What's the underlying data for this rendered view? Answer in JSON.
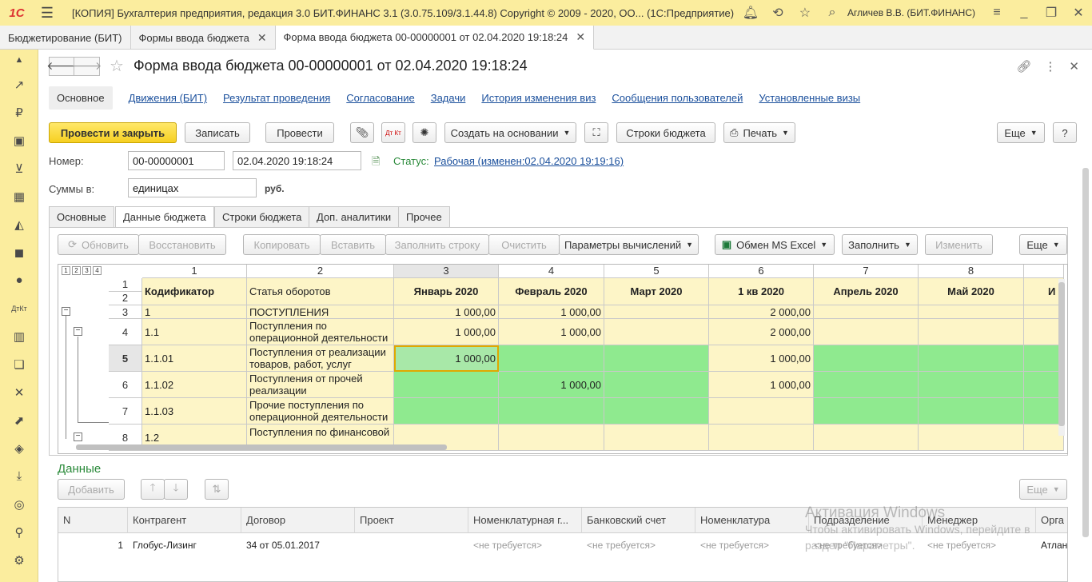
{
  "topbar": {
    "title": "[КОПИЯ] Бухгалтерия предприятия, редакция 3.0  БИТ.ФИНАНС 3.1 (3.0.75.109/3.1.44.8) Copyright © 2009 - 2020, ОО...   (1С:Предприятие)",
    "user": "Агличев В.В. (БИТ.ФИНАНС)",
    "logo": "1С"
  },
  "window_tabs": [
    {
      "label": "Бюджетирование (БИТ)"
    },
    {
      "label": "Формы ввода бюджета"
    },
    {
      "label": "Форма ввода бюджета 00-00000001 от 02.04.2020 19:18:24"
    }
  ],
  "form": {
    "title": "Форма ввода бюджета 00-00000001 от 02.04.2020 19:18:24",
    "links": [
      "Основное",
      "Движения (БИТ)",
      "Результат проведения",
      "Согласование",
      "Задачи",
      "История изменения виз",
      "Сообщения пользователей",
      "Установленные визы"
    ],
    "buttons": {
      "post_close": "Провести и закрыть",
      "save": "Записать",
      "post": "Провести",
      "create_based": "Создать на основании",
      "budget_rows": "Строки бюджета",
      "print": "Печать",
      "more": "Еще",
      "help": "?",
      "dtkt": "Дт Кт"
    },
    "number_label": "Номер:",
    "number_value": "00-00000001",
    "date_value": "02.04.2020 19:18:24",
    "status_label": "Статус:",
    "status_value": "Рабочая (изменен:02.04.2020 19:19:16)",
    "sums_label": "Суммы в:",
    "sums_value": "единицах",
    "currency": "руб."
  },
  "panel_tabs": [
    "Основные",
    "Данные бюджета",
    "Строки бюджета",
    "Доп. аналитики",
    "Прочее"
  ],
  "grid_toolbar": {
    "refresh": "Обновить",
    "restore": "Восстановить",
    "copy": "Копировать",
    "paste": "Вставить",
    "fill_row": "Заполнить строку",
    "clear": "Очистить",
    "calc_params": "Параметры вычислений",
    "excel": "Обмен MS Excel",
    "fill": "Заполнить",
    "change": "Изменить",
    "more": "Еще"
  },
  "grid": {
    "levels": [
      "1",
      "2",
      "3",
      "4"
    ],
    "col_numbers": [
      "1",
      "2",
      "3",
      "4",
      "5",
      "6",
      "7",
      "8"
    ],
    "header_row_numbers": [
      "1",
      "2"
    ],
    "headers": [
      "Кодификатор",
      "Статья оборотов",
      "Январь 2020",
      "Февраль 2020",
      "Март 2020",
      "1 кв 2020",
      "Апрель 2020",
      "Май 2020",
      "И"
    ],
    "rows": [
      {
        "n": "3",
        "code": "1",
        "name": "ПОСТУПЛЕНИЯ",
        "jan": "1 000,00",
        "feb": "1 000,00",
        "mar": "",
        "q1": "2 000,00",
        "apr": "",
        "may": ""
      },
      {
        "n": "4",
        "code": "1.1",
        "name": "Поступления по операционной деятельности",
        "jan": "1 000,00",
        "feb": "1 000,00",
        "mar": "",
        "q1": "2 000,00",
        "apr": "",
        "may": ""
      },
      {
        "n": "5",
        "code": "1.1.01",
        "name": "Поступления от реализации товаров, работ, услуг",
        "jan": "1 000,00",
        "feb": "",
        "mar": "",
        "q1": "1 000,00",
        "apr": "",
        "may": ""
      },
      {
        "n": "6",
        "code": "1.1.02",
        "name": "Поступления от прочей реализации",
        "jan": "",
        "feb": "1 000,00",
        "mar": "",
        "q1": "1 000,00",
        "apr": "",
        "may": ""
      },
      {
        "n": "7",
        "code": "1.1.03",
        "name": "Прочие поступления по операционной деятельности",
        "jan": "",
        "feb": "",
        "mar": "",
        "q1": "",
        "apr": "",
        "may": ""
      },
      {
        "n": "8",
        "code": "1.2",
        "name": "Поступления по финансовой",
        "jan": "",
        "feb": "",
        "mar": "",
        "q1": "",
        "apr": "",
        "may": ""
      }
    ]
  },
  "data_section": {
    "title": "Данные",
    "add": "Добавить",
    "more": "Еще",
    "columns": [
      "N",
      "Контрагент",
      "Договор",
      "Проект",
      "Номенклатурная г...",
      "Банковский счет",
      "Номенклатура",
      "Подразделение",
      "Менеджер",
      "Орга"
    ],
    "rows": [
      {
        "n": "1",
        "counterparty": "Глобус-Лизинг",
        "contract": "34 от 05.01.2017",
        "project": "",
        "nom_group": "<не требуется>",
        "bank": "<не требуется>",
        "nomenclature": "<не требуется>",
        "division": "<не требуется>",
        "manager": "<не требуется>",
        "org": "Атлан"
      }
    ]
  },
  "watermark": {
    "line1": "Активация Windows",
    "line2": "Чтобы активировать Windows, перейдите в",
    "line3": "раздел \"Параметры\"."
  },
  "colors": {
    "topbar": "#fbed9e",
    "accent_button": "#f6cf21",
    "green_cell": "#8fea8f",
    "yellow_cell": "#fdf5c7",
    "link": "#1a4f9c"
  }
}
